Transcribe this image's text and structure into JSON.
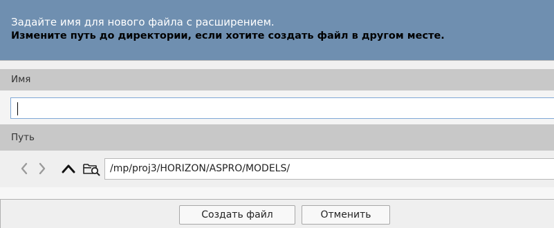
{
  "header": {
    "line1": "Задайте имя для нового файла с расширением.",
    "line2": "Измените путь до директории, если хотите создать файл в другом месте."
  },
  "name_section": {
    "label": "Имя",
    "value": ""
  },
  "path_section": {
    "label": "Путь",
    "value": "/mp/proj3/HORIZON/ASPRO/MODELS/",
    "nav_icons": [
      "back-arrow-icon",
      "forward-arrow-icon",
      "up-arrow-icon",
      "browse-folder-icon"
    ]
  },
  "buttons": {
    "create": "Создать файл",
    "cancel": "Отменить"
  },
  "colors": {
    "header_bg": "#6f8fb0",
    "label_band_bg": "#c8c8c8",
    "focus_border": "#7ea7d6",
    "panel_bg": "#efefef"
  }
}
